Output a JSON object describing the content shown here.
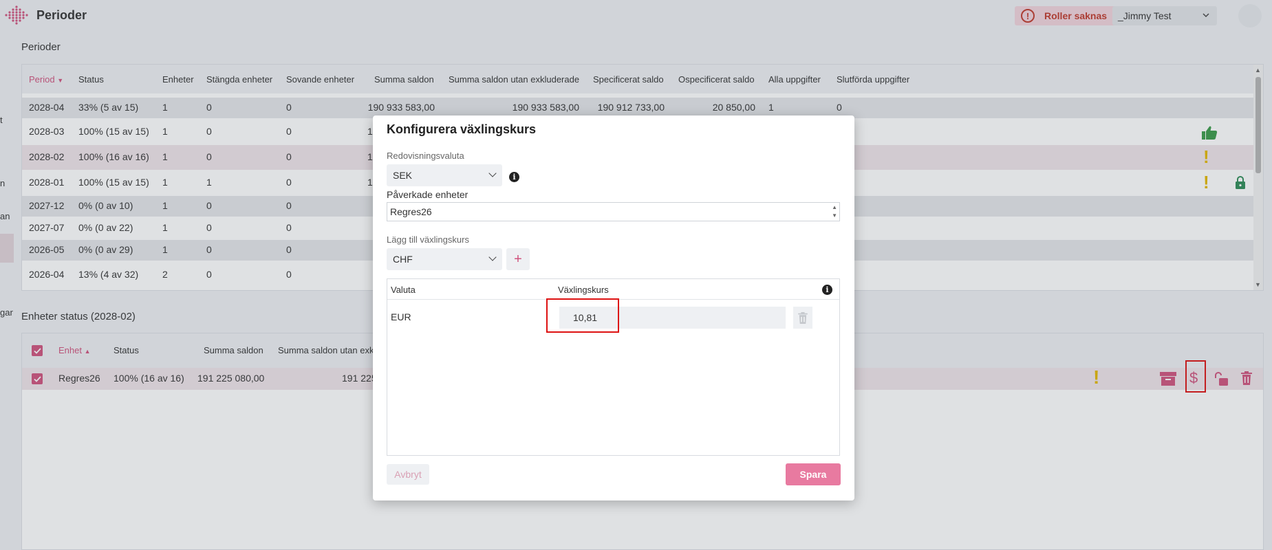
{
  "header": {
    "title": "Perioder",
    "warning_label": "Roller saknas",
    "warning_mark": "!",
    "user": "_Jimmy Test"
  },
  "leftnav": {
    "fragments": [
      "t",
      "n",
      "an",
      "gar"
    ]
  },
  "periods": {
    "section_title": "Perioder",
    "columns": [
      "Period",
      "Status",
      "Enheter",
      "Stängda enheter",
      "Sovande enheter",
      "Summa saldon",
      "Summa saldon utan exkluderade",
      "Specificerat saldo",
      "Ospecificerat saldo",
      "Alla uppgifter",
      "Slutförda uppgifter"
    ],
    "sort_arrow": "▼",
    "rows": [
      {
        "period": "2028-04",
        "status": "33% (5 av 15)",
        "units": "1",
        "closed": "0",
        "dormant": "0",
        "sum": "190 933 583,00",
        "sum_excl": "190 933 583,00",
        "spec": "190 912 733,00",
        "unspec": "20 850,00",
        "all": "1",
        "done": "0"
      },
      {
        "period": "2028-03",
        "status": "100% (15 av 15)",
        "units": "1",
        "closed": "0",
        "dormant": "0",
        "sum_partial": "1"
      },
      {
        "period": "2028-02",
        "status": "100% (16 av 16)",
        "units": "1",
        "closed": "0",
        "dormant": "0",
        "sum_partial": "1"
      },
      {
        "period": "2028-01",
        "status": "100% (15 av 15)",
        "units": "1",
        "closed": "1",
        "dormant": "0",
        "sum_partial": "1"
      },
      {
        "period": "2027-12",
        "status": "0% (0 av 10)",
        "units": "1",
        "closed": "0",
        "dormant": "0"
      },
      {
        "period": "2027-07",
        "status": "0% (0 av 22)",
        "units": "1",
        "closed": "0",
        "dormant": "0"
      },
      {
        "period": "2026-05",
        "status": "0% (0 av 29)",
        "units": "1",
        "closed": "0",
        "dormant": "0"
      },
      {
        "period": "2026-04",
        "status": "13% (4 av 32)",
        "units": "2",
        "closed": "0",
        "dormant": "0"
      }
    ],
    "exclamation": "!"
  },
  "units": {
    "section_title": "Enheter status (2028-02)",
    "columns": [
      "Enhet",
      "Status",
      "Summa saldon",
      "Summa saldon utan exk"
    ],
    "sort_arrow": "▲",
    "row": {
      "unit": "Regres26",
      "status": "100% (16 av 16)",
      "sum": "191 225 080,00",
      "sum_excl_partial": "191 225"
    },
    "exclamation": "!",
    "dollar": "$"
  },
  "modal": {
    "title": "Konfigurera växlingskurs",
    "currency_label": "Redovisningsvaluta",
    "currency_value": "SEK",
    "affected_label": "Påverkade enheter",
    "affected_value": "Regres26",
    "add_label": "Lägg till växlingskurs",
    "add_currency": "CHF",
    "add_button": "+",
    "info_glyph": "i",
    "table": {
      "col_currency": "Valuta",
      "col_rate": "Växlingskurs",
      "rows": [
        {
          "currency": "EUR",
          "rate": "10,81"
        }
      ]
    },
    "cancel": "Avbryt",
    "save": "Spara"
  },
  "colors": {
    "accent": "#d0527d",
    "save": "#e87aa0",
    "warning": "#e5b800",
    "success": "#3a9a48",
    "lock": "#2e8b57",
    "error": "#c0392b"
  }
}
